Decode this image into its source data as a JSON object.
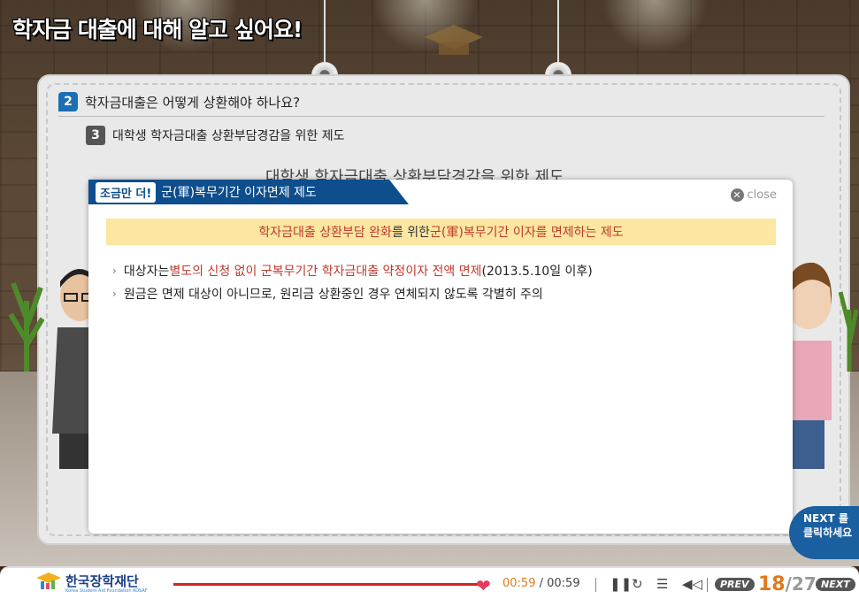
{
  "header": {
    "title": "학자금 대출에 대해 알고 싶어요!"
  },
  "lesson": {
    "step2": {
      "number": "2",
      "text": "학자금대출은 어떻게 상환해야 하나요?"
    },
    "step3": {
      "number": "3",
      "text": "대학생 학자금대출 상환부담경감을 위한 제도"
    },
    "background_heading": "대학생 학자금대출 상환부담경감을 위한 제도"
  },
  "popup": {
    "badge": "조금만 더!",
    "title": "군(軍)복무기간 이자면제 제도",
    "close_label": "close",
    "summary": {
      "part1": "학자금대출 상환부담 완화",
      "part2": "를 위한 ",
      "part3": "군(軍)복무기간 이자를 면제하는 제도"
    },
    "bullets": [
      {
        "pre": "대상자는 ",
        "highlight": "별도의 신청 없이 군복무기간 학자금대출 약정이자 전액 면제",
        "post": " (2013.5.10일 이후)"
      },
      {
        "pre": "원금은 면제 대상이 아니므로, 원리금 상환중인 경우 연체되지 않도록 각별히 주의",
        "highlight": "",
        "post": ""
      }
    ]
  },
  "next_hint": {
    "line1": "NEXT 를",
    "line2": "클릭하세요"
  },
  "player": {
    "logo_text": "한국장학재단",
    "logo_sub": "Korea Student Aid Foundation KOSAF",
    "time_current": "00:59",
    "time_sep": " / ",
    "time_total": "00:59",
    "progress": 1.0,
    "prev_label": "PREV",
    "next_label": "NEXT",
    "page_current": "18",
    "page_total": "/27"
  },
  "colors": {
    "accent": "#0e4e8c",
    "highlight": "#c0392b",
    "summary_bg": "#fbe6a2",
    "progress": "#d62222"
  }
}
